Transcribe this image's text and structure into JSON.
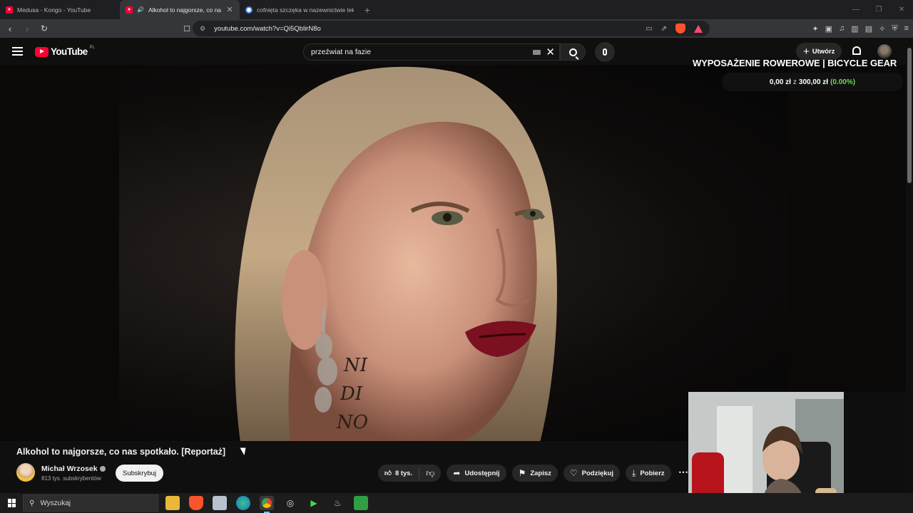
{
  "browser": {
    "tabs": [
      {
        "title": "Medusa - Kongo - YouTube",
        "favicon": "youtube-icon"
      },
      {
        "title": "Alkohol to najgorsze, co nas",
        "favicon": "youtube-icon",
        "active": true
      },
      {
        "title": "cofnięta szczęka w nazewnictwie leka",
        "favicon": "google-icon"
      }
    ],
    "url": "youtube.com/watch?v=Qi5QblirN8o"
  },
  "youtube": {
    "logo_text": "YouTube",
    "country_code": "PL",
    "search_query": "przeźwiat na fazie",
    "create_label": "Utwórz"
  },
  "overlay": {
    "goal_title": "WYPOSAŻENIE ROWEROWE | BICYCLE GEAR",
    "goal_current": "0,00 zł",
    "goal_sep": "z",
    "goal_target": "300,00 zł",
    "goal_percent": "(0.00%)"
  },
  "video": {
    "title": "Alkohol to najgorsze, co nas spotkało. [Reportaż]",
    "channel_name": "Michał Wrzosek",
    "channel_subs": "813 tys. subskrybentów",
    "subscribe_label": "Subskrybuj",
    "likes": "8 tys.",
    "share_label": "Udostępnij",
    "save_label": "Zapisz",
    "thanks_label": "Podziękuj",
    "download_label": "Pobierz"
  },
  "taskbar": {
    "search_label": "Wyszukaj"
  },
  "colors": {
    "brand_red": "#ff0033",
    "goal_green": "#6fdc4f",
    "background": "#0f0f0f"
  }
}
